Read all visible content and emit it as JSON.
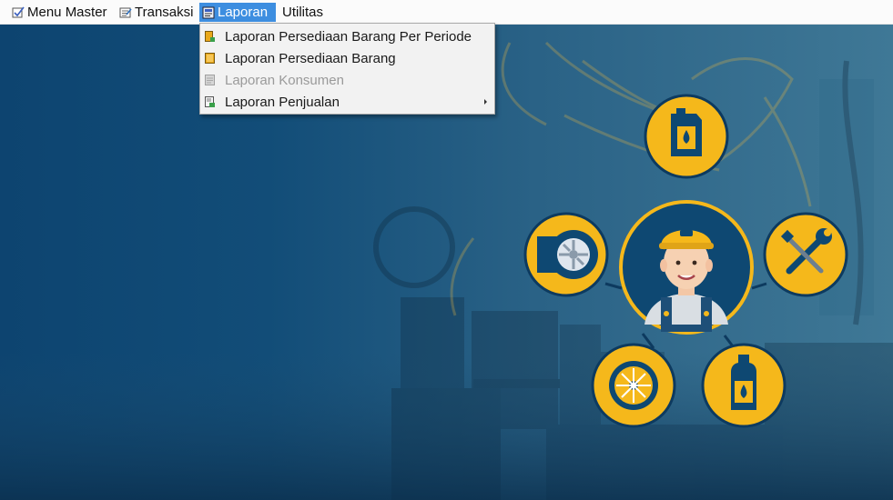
{
  "menubar": {
    "items": [
      {
        "label": "Menu Master",
        "icon": "master-icon"
      },
      {
        "label": "Transaksi",
        "icon": "transaksi-icon"
      },
      {
        "label": "Laporan",
        "icon": "report-icon",
        "active": true
      },
      {
        "label": "Utilitas"
      }
    ]
  },
  "laporan_menu": {
    "items": [
      {
        "label": "Laporan Persediaan Barang Per Periode",
        "icon": "report-period-icon",
        "enabled": true
      },
      {
        "label": "Laporan Persediaan Barang",
        "icon": "report-stock-icon",
        "enabled": true
      },
      {
        "label": "Laporan Konsumen",
        "icon": "report-customer-icon",
        "enabled": false
      },
      {
        "label": "Laporan Penjualan",
        "icon": "report-sales-icon",
        "enabled": true,
        "has_submenu": true
      }
    ]
  },
  "background": {
    "icons": [
      "oil-canister-icon",
      "tire-icon",
      "mechanic-avatar",
      "tools-icon",
      "wheel-icon",
      "oil-bottle-icon"
    ],
    "colors": {
      "panel": "#0e4872",
      "circle": "#f5b81b",
      "circle_border": "#0d3a5f",
      "accent": "#3d8ee0"
    }
  }
}
